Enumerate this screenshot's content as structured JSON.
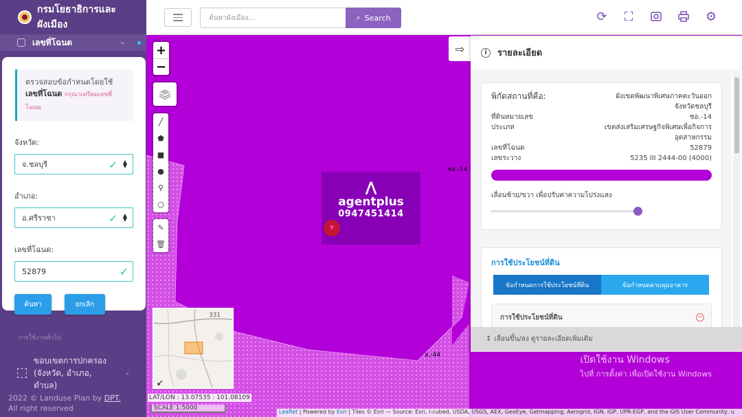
{
  "sidebar": {
    "title": "กรมโยธาธิการและผังเมือง",
    "menu_active": "เลขที่โฉนด",
    "notice_text": "ตรวจสอบข้อกำหนดโดยใช้",
    "notice_bold": "เลขที่โฉนด",
    "notice_hint": "กรุณาเตรียมเลขที่โฉนด",
    "province_label": "จังหวัด:",
    "province_value": "จ.ชลบุรี",
    "district_label": "อำเภอ:",
    "district_value": "อ.ศรีราชา",
    "deed_label": "เลขที่โฉนด:",
    "deed_value": "52879",
    "search_label": "ค้นหา",
    "cancel_label": "ยกเลิก",
    "group_title": "การใช้งานทั่วไป",
    "admin_item_line1": "ขอบเขตการปกครอง",
    "admin_item_line2": "(จังหวัด, อำเภอ, ตำบล)",
    "copyright_line1": "2022 © Landuse Plan by ",
    "copyright_link": "DPT.",
    "copyright_line2": "All right reserved"
  },
  "topbar": {
    "search_placeholder": "ค้นหาผังเมือง...",
    "search_button": "Search",
    "icons": [
      "refresh-icon",
      "fullscreen-icon",
      "screenshot-icon",
      "print-icon",
      "gear-icon"
    ]
  },
  "map": {
    "coords": "LAT/LON : 13.07535 : 101.08109",
    "scale": "SCALE 1:5000",
    "attribution_link": "Leaflet",
    "attribution_text": " | Powered by ",
    "attribution_esri": "Esri",
    "attribution_rest": " | Tiles © Esri — Source: Esri, i-cubed, USDA, USGS, AEX, GeoEye, Getmapping, Aerogrid, IGN, IGP, UPR-EGP, and the GIS User Community, u",
    "label_top": "ชอ.-14",
    "label_bottom": "ส.-44",
    "minimap_label": "331",
    "watermark_brand": "agentplus",
    "watermark_phone": "0947451414",
    "windows_line1": "เปิดใช้งาน Windows",
    "windows_line2": "ไปที่ การตั้งค่า เพื่อเปิดใช้งาน Windows",
    "colors": {
      "zone": "#b400d8",
      "accent": "#8d63c2"
    }
  },
  "detail": {
    "title": "รายละเอียด",
    "rows": [
      {
        "k": "พิกัดสถานที่คือ:",
        "v": "ผังเขตพัฒนาพิเศษภาคตะวันออก จังหวัดชลบุรี"
      },
      {
        "k": "ที่ดินหมายเลข",
        "v": "ชอ.-14"
      },
      {
        "k": "ประเภท",
        "v": "เขตส่งเสริมเศรษฐกิจพิเศษเพื่อกิจการอุตสาหกรรม"
      },
      {
        "k": "เลขที่โฉนด",
        "v": "52879"
      },
      {
        "k": "เลขระวาง",
        "v": "5235 III 2444-00 (4000)"
      }
    ],
    "slider_label": "เลื่อนซ้าย/ขวา เพื่อปรับค่าความโปร่งแสง",
    "opacity_value": 0.97,
    "landuse_heading": "การใช้ประโยชน์ที่ดิน",
    "tab1": "ข้อกำหนดการใช้ประโยชน์ที่ดิน",
    "tab2": "ข้อกำหนดควบคุมอาคาร",
    "accordion": "การใช้ประโยชน์ที่ดิน",
    "drag_hint": "เลื่อนขึ้น/ลง ดูรายละเอียดเพิ่มเติม"
  }
}
